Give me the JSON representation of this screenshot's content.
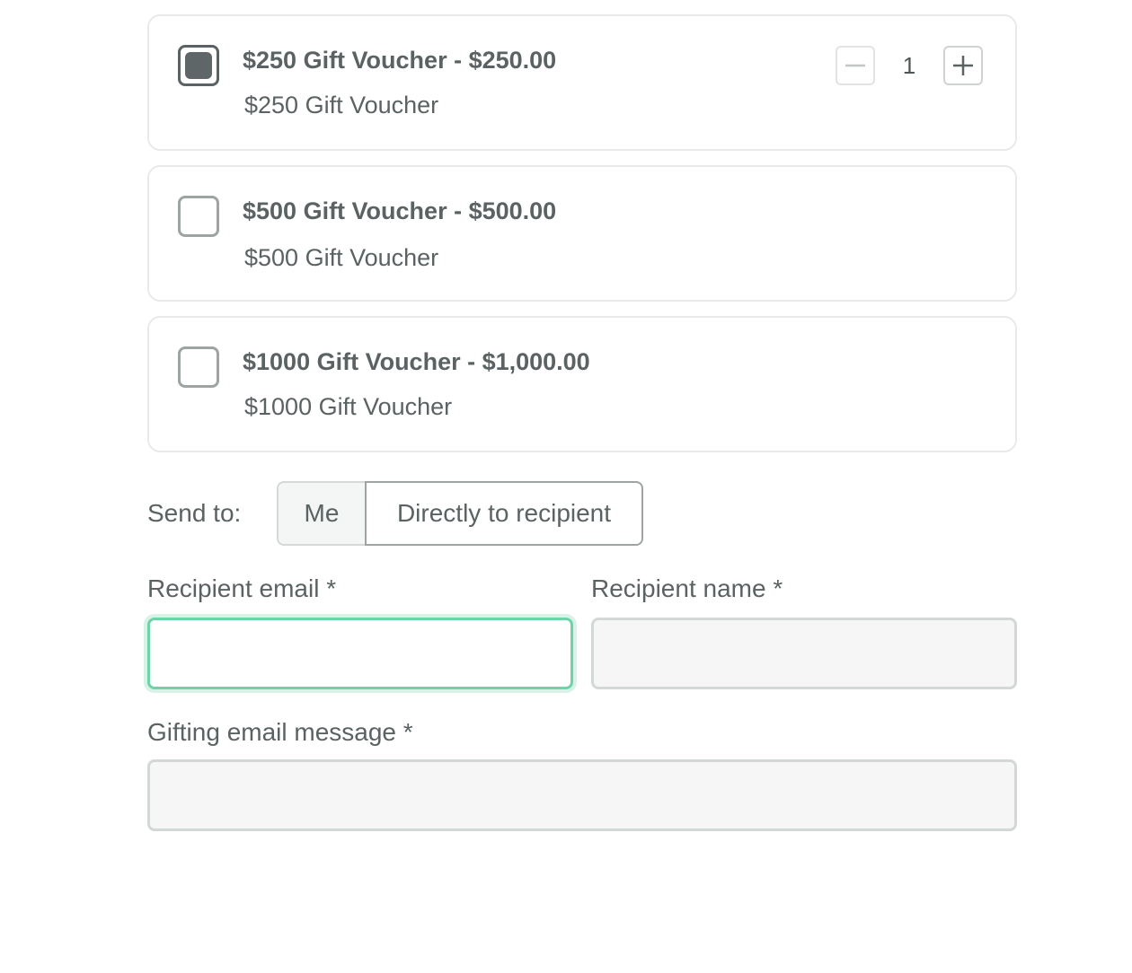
{
  "vouchers": [
    {
      "title": "$250 Gift Voucher - $250.00",
      "subtitle": "$250 Gift Voucher",
      "checked": true,
      "quantity": "1"
    },
    {
      "title": "$500 Gift Voucher - $500.00",
      "subtitle": "$500 Gift Voucher",
      "checked": false
    },
    {
      "title": "$1000 Gift Voucher - $1,000.00",
      "subtitle": "$1000 Gift Voucher",
      "checked": false
    }
  ],
  "send_to": {
    "label": "Send to:",
    "options": [
      "Me",
      "Directly to recipient"
    ],
    "selected": "Directly to recipient"
  },
  "form": {
    "recipient_email": {
      "label": "Recipient email *",
      "value": ""
    },
    "recipient_name": {
      "label": "Recipient name *",
      "value": ""
    },
    "message": {
      "label": "Gifting email message *",
      "value": ""
    }
  },
  "icons": {
    "decrement": "minus-icon",
    "increment": "plus-icon"
  },
  "colors": {
    "text": "#5b6263",
    "focus_border": "#6fd3a8",
    "checkbox_fill": "#5f6667"
  }
}
